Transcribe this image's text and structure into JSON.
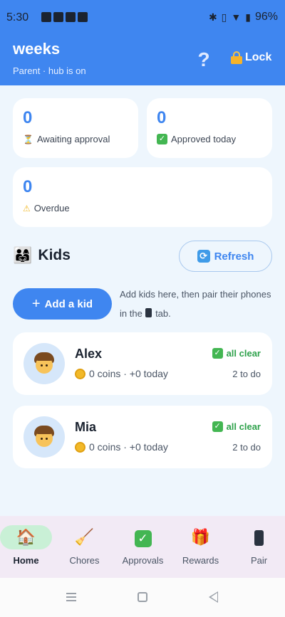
{
  "status_bar": {
    "time": "5:30",
    "battery": "96%"
  },
  "header": {
    "title": "weeks",
    "subtitle": "Parent · hub is on",
    "help_label": "?",
    "lock_label": "Lock"
  },
  "stats": [
    {
      "value": "0",
      "label": "Awaiting approval",
      "icon": "hourglass-icon"
    },
    {
      "value": "0",
      "label": "Approved today",
      "icon": "check-icon"
    },
    {
      "value": "0",
      "label": "Overdue",
      "icon": "warning-icon"
    }
  ],
  "kids_section": {
    "title": "Kids",
    "refresh_label": "Refresh",
    "add_label": "Add a kid",
    "hint_before": "Add kids here, then pair their phones in the",
    "hint_after": "tab."
  },
  "kids": [
    {
      "name": "Alex",
      "coins": "0 coins · +0 today",
      "status": "all clear",
      "todo": "2 to do"
    },
    {
      "name": "Mia",
      "coins": "0 coins · +0 today",
      "status": "all clear",
      "todo": "2 to do"
    }
  ],
  "nav": [
    {
      "label": "Home",
      "icon": "house-icon"
    },
    {
      "label": "Chores",
      "icon": "broom-icon"
    },
    {
      "label": "Approvals",
      "icon": "check-icon"
    },
    {
      "label": "Rewards",
      "icon": "gift-icon"
    },
    {
      "label": "Pair",
      "icon": "phone-icon"
    }
  ],
  "colors": {
    "primary": "#3f86f0",
    "success": "#2fa24c",
    "background": "#eef6fd",
    "nav_active": "#c9f0d6"
  }
}
